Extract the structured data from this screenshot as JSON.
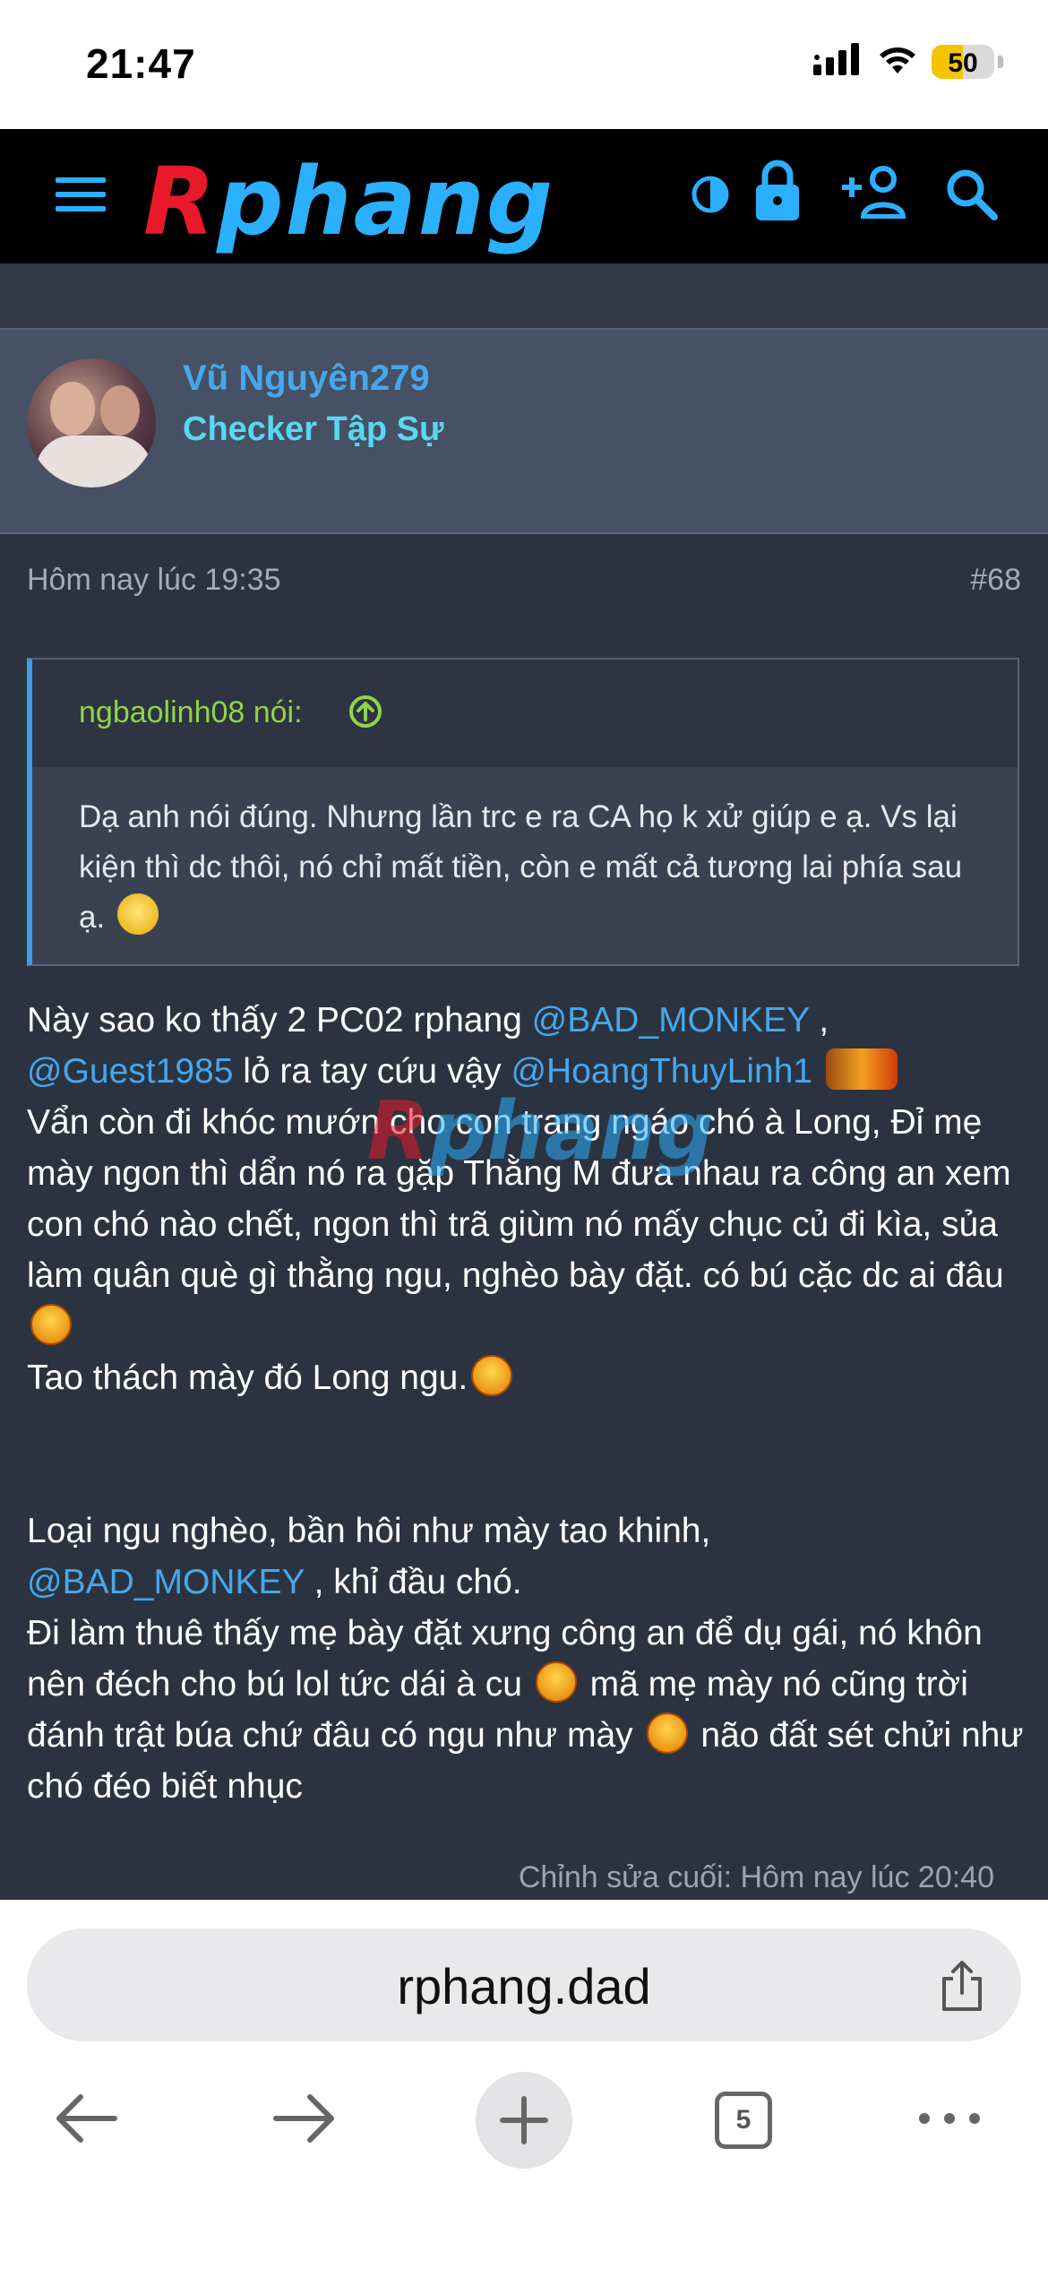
{
  "status_bar": {
    "time": "21:47",
    "battery": "50",
    "battery_level": 0.5,
    "icons": [
      "signal-icon",
      "wifi-icon",
      "battery-icon"
    ]
  },
  "site_header": {
    "logo_r": "R",
    "logo_rest": "phang",
    "icons": [
      "menu-icon",
      "theme-toggle-icon",
      "lock-icon",
      "add-user-icon",
      "search-icon"
    ],
    "accent": "#2bb0ff",
    "logo_red": "#e9192a"
  },
  "post": {
    "author": "Vũ Nguyên279",
    "user_title": "Checker Tập Sự",
    "date": "Hôm nay lúc 19:35",
    "number": "#68",
    "quote": {
      "author": "ngbaolinh08 nói:",
      "text": "Dạ anh nói đúng. Nhưng lần trc e ra CA họ k xử giúp e ạ. Vs lại kiện thì dc thôi, nó chỉ mất tiền, còn e mất cả tương lai phía sau ạ."
    },
    "body": {
      "p1_a": "Này sao ko thấy 2 PC02 rphang ",
      "mention_1": "@BAD_MONKEY",
      "p1_b": " ,",
      "mention_2": "@Guest1985",
      "p1_c": " lỏ ra tay cứu vậy ",
      "mention_3": "@HoangThuyLinh1",
      "p1_d": "Vẩn còn đi khóc mướn cho con trang ngáo chó à Long, Đỉ mẹ mày ngon thì dẩn nó ra gặp Thằng M đưa nhau ra công an xem con chó nào chết, ngon thì trã giùm nó mấy chục củ đi kìa, sủa làm quân què gì thằng ngu, nghèo bày đặt. có bú cặc dc ai đâu",
      "p1_e": "Tao thách mày đó Long ngu.",
      "p2_a": "Loại ngu nghèo, bần hôi như mày tao khinh,",
      "mention_4": "@BAD_MONKEY",
      "p2_b": " , khỉ đầu chó.",
      "p2_c": "Đi làm thuê thấy mẹ bày đặt xưng công an để dụ gái, nó khôn nên đéch cho bú lol tức dái à cu",
      "p2_d": " mã mẹ mày nó cũng trời đánh trật búa chứ đâu có ngu như mày",
      "p2_e": " não đất sét chửi như chó đéo biết nhục"
    },
    "edited": "Chỉnh sửa cuối: Hôm nay lúc 20:40"
  },
  "browser": {
    "url": "rphang.dad",
    "tab_count": "5",
    "nav_icons": [
      "back-icon",
      "forward-icon",
      "new-tab-icon",
      "tabs-icon",
      "more-icon"
    ]
  }
}
